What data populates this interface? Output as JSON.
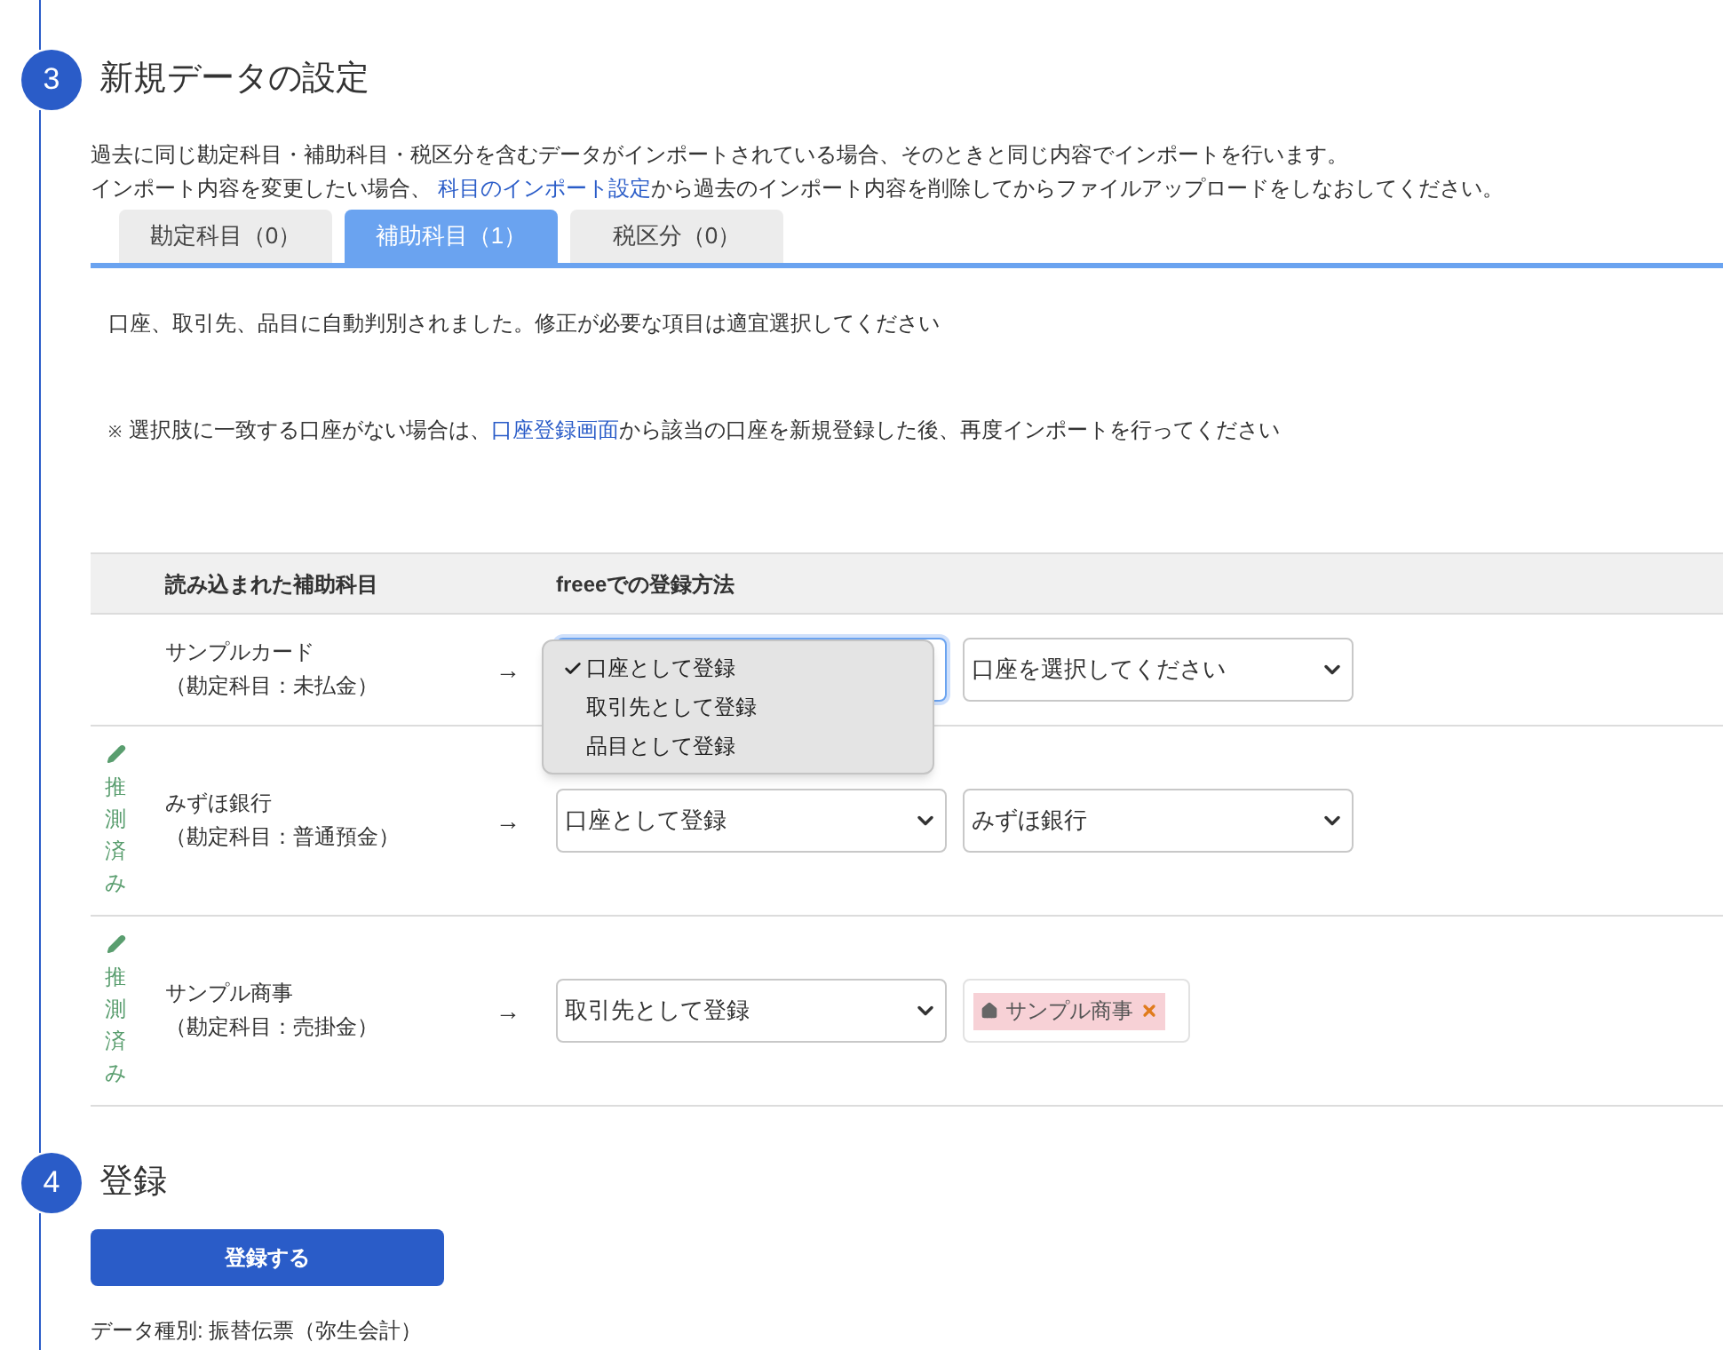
{
  "step3": {
    "number": "3",
    "title": "新規データの設定",
    "description": [
      "過去に同じ勘定科目・補助科目・税区分を含むデータがインポートされている場合、そのときと同じ内容でインポートを行います。",
      {
        "before": "インポート内容を変更したい場合、 ",
        "link": "科目のインポート設定",
        "after": "から過去のインポート内容を削除してからファイルアップロードをしなおしてください。"
      }
    ],
    "tabs": [
      {
        "label": "勘定科目（0）",
        "selected": false
      },
      {
        "label": "補助科目（1）",
        "selected": true
      },
      {
        "label": "税区分（0）",
        "selected": false
      }
    ],
    "info": "口座、取引先、品目に自動判別されました。修正が必要な項目は適宜選択してください",
    "note": {
      "mark": "※",
      "before": " 選択肢に一致する口座がない場合は、",
      "link": "口座登録画面",
      "after": "から該当の口座を新規登録した後、再度インポートを行ってください"
    },
    "table": {
      "columns": [
        "読み込まれた補助科目",
        "freeeでの登録方法"
      ],
      "rows": [
        {
          "badge": null,
          "name": "サンプルカード",
          "account": "（勘定科目：未払金）",
          "arrow": "→",
          "method": {
            "focused": true,
            "menu": [
              {
                "label": "口座として登録",
                "selected": true
              },
              {
                "label": "取引先として登録",
                "selected": false
              },
              {
                "label": "品目として登録",
                "selected": false
              }
            ]
          },
          "target": {
            "kind": "select",
            "value": "口座を選択してください"
          }
        },
        {
          "badge": "推測済み",
          "name": "みずほ銀行",
          "account": "（勘定科目：普通預金）",
          "arrow": "→",
          "method": {
            "value": "口座として登録",
            "focused": false
          },
          "target": {
            "kind": "select",
            "value": "みずほ銀行"
          }
        },
        {
          "badge": "推測済み",
          "name": "サンプル商事",
          "account": "（勘定科目：売掛金）",
          "arrow": "→",
          "method": {
            "value": "取引先として登録",
            "focused": false
          },
          "target": {
            "kind": "tag",
            "value": "サンプル商事"
          }
        }
      ]
    }
  },
  "step4": {
    "number": "4",
    "title": "登録",
    "button": "登録する",
    "data_type": "データ種別: 振替伝票（弥生会計）"
  }
}
